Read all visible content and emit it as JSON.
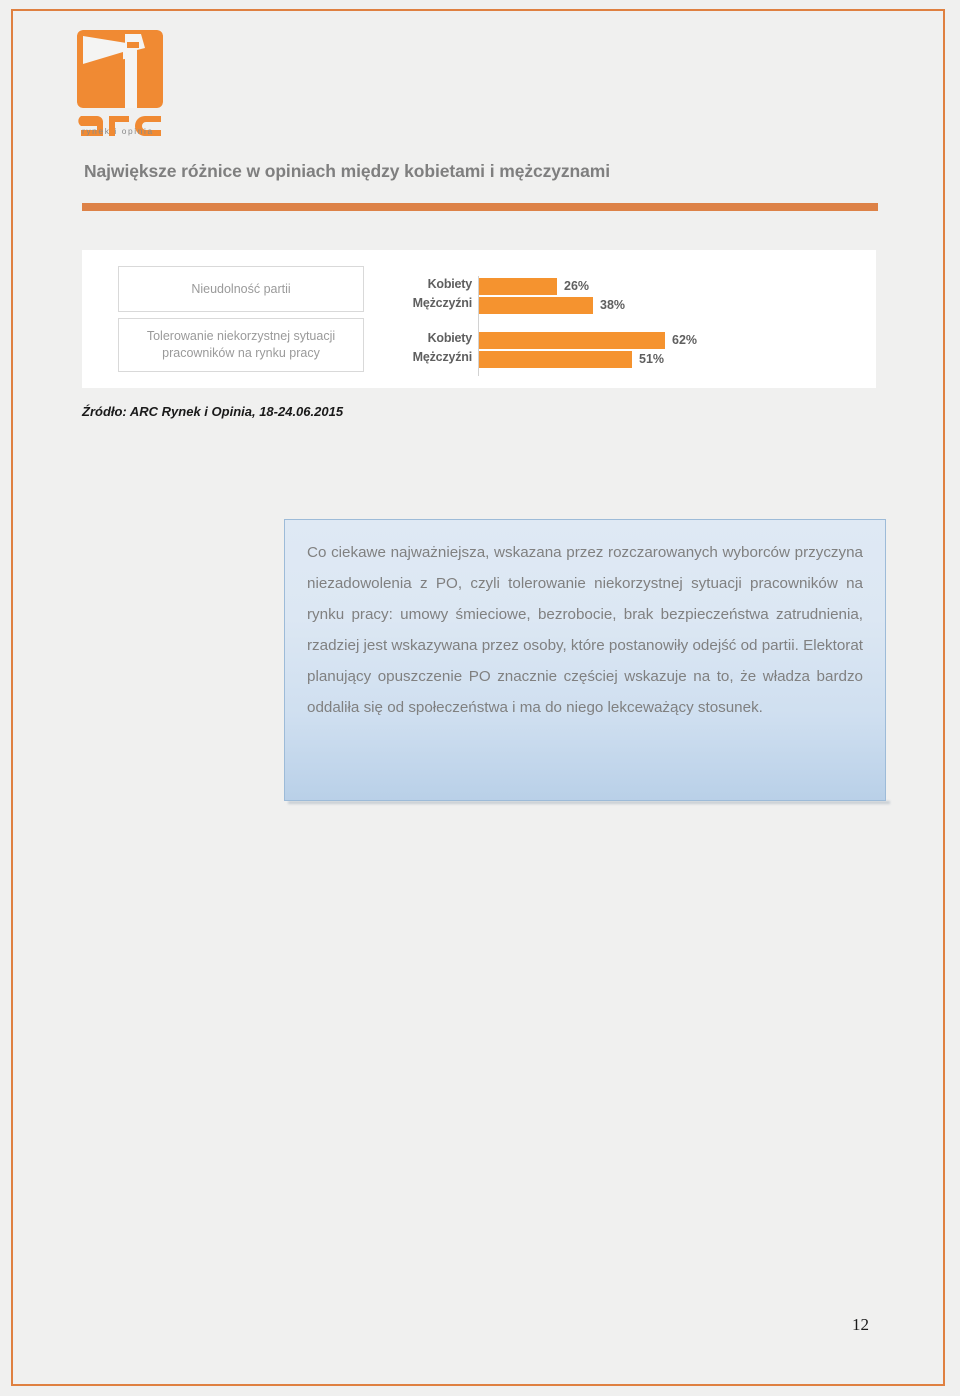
{
  "document": {
    "page_number": "12",
    "frame_color": "#df8040",
    "background_color": "#f0f0ef"
  },
  "logo": {
    "name": "arc-logo",
    "wordmark": "arc",
    "tagline": "rynek i opinia",
    "color": "#f08a33"
  },
  "slide": {
    "title": "Największe różnice w opiniach między kobietami i mężczyznami",
    "title_color": "#7f7f7f",
    "rule_color": "#dd8247"
  },
  "chart_data": {
    "type": "bar",
    "orientation": "horizontal",
    "title": "",
    "xlabel": "",
    "ylabel": "",
    "xlim": [
      0,
      100
    ],
    "grid": false,
    "legend_position": "none",
    "value_suffix": "%",
    "bar_color": "#f5932f",
    "categories": [
      "Nieudolność partii",
      "Tolerowanie niekorzystnej sytuacji pracowników na rynku pracy"
    ],
    "series": [
      {
        "name": "Kobiety",
        "values": [
          26,
          62
        ]
      },
      {
        "name": "Mężczyźni",
        "values": [
          38,
          51
        ]
      }
    ],
    "bars": [
      {
        "category": "Nieudolność partii",
        "series": "Kobiety",
        "value": 26,
        "label": "26%"
      },
      {
        "category": "Nieudolność partii",
        "series": "Mężczyźni",
        "value": 38,
        "label": "38%"
      },
      {
        "category": "Tolerowanie niekorzystnej sytuacji pracowników na rynku pracy",
        "series": "Kobiety",
        "value": 62,
        "label": "62%"
      },
      {
        "category": "Tolerowanie niekorzystnej sytuacji pracowników na rynku pracy",
        "series": "Mężczyźni",
        "value": 51,
        "label": "51%"
      }
    ]
  },
  "source": {
    "text": "Źródło: ARC Rynek i Opinia, 18-24.06.2015"
  },
  "commentary": {
    "paragraph": "Co ciekawe najważniejsza, wskazana przez rozczarowanych wyborców przyczyna niezadowolenia z PO, czyli tolerowanie niekorzystnej sytuacji pracowników na rynku pracy: umowy śmieciowe, bezrobocie, brak bezpieczeństwa zatrudnienia, rzadziej jest wskazywana przez osoby, które postanowiły odejść od partii. Elektorat planujący opuszczenie PO znacznie częściej wskazuje na to, że władza bardzo oddaliła się od społeczeństwa i ma do niego lekceważący stosunek."
  }
}
